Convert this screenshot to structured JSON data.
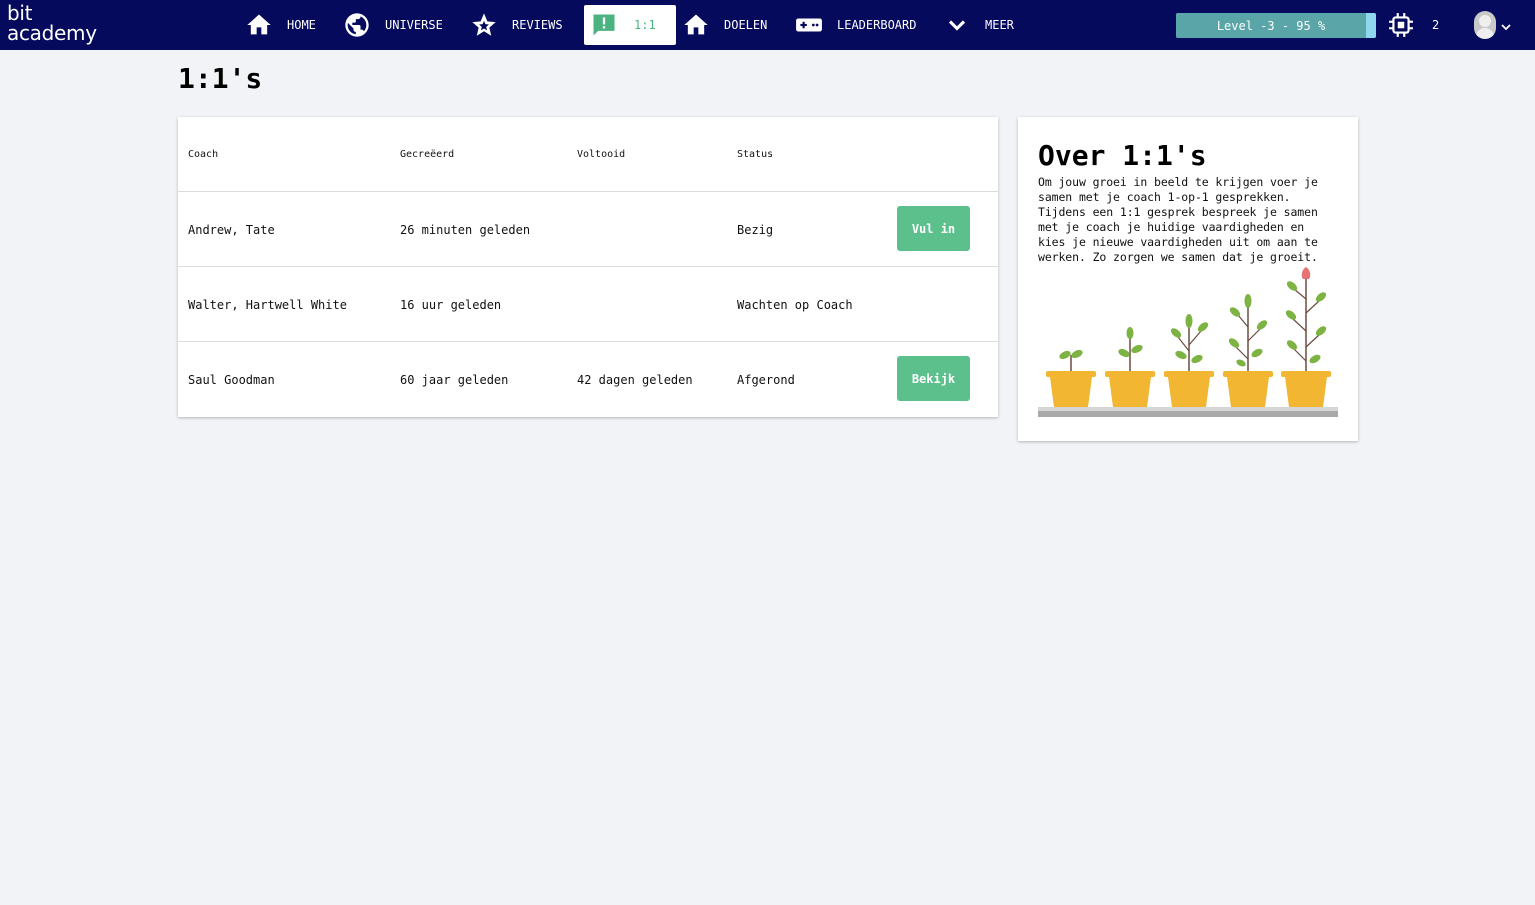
{
  "app": {
    "logo_line1": "bit",
    "logo_line2": "academy"
  },
  "nav": {
    "items": [
      {
        "label": "HOME",
        "icon": "home-icon"
      },
      {
        "label": "UNIVERSE",
        "icon": "globe-icon"
      },
      {
        "label": "REVIEWS",
        "icon": "star-icon"
      },
      {
        "label": "1:1",
        "icon": "chat-alert-icon",
        "active": true
      },
      {
        "label": "DOELEN",
        "icon": "home-icon"
      },
      {
        "label": "LEADERBOARD",
        "icon": "gamepad-icon"
      },
      {
        "label": "MEER",
        "icon": "chevron-down-icon"
      }
    ]
  },
  "level": {
    "text": "Level -3 - 95 %",
    "progress": 0.95
  },
  "chip_count": "2",
  "page": {
    "title": "1:1's"
  },
  "table": {
    "headers": [
      "Coach",
      "Gecreëerd",
      "Voltooid",
      "Status"
    ],
    "rows": [
      {
        "coach": "Andrew, Tate",
        "created": "26 minuten geleden",
        "completed": "",
        "status": "Bezig",
        "action": "Vul in"
      },
      {
        "coach": "Walter, Hartwell White",
        "created": "16 uur geleden",
        "completed": "",
        "status": "Wachten op Coach",
        "action": ""
      },
      {
        "coach": "Saul Goodman",
        "created": "60 jaar geleden",
        "completed": "42 dagen geleden",
        "status": "Afgerond",
        "action": "Bekijk"
      }
    ]
  },
  "info": {
    "title": "Over 1:1's",
    "text": "Om jouw groei in beeld te krijgen voer je samen met je coach 1-op-1 gesprekken. Tijdens een 1:1 gesprek bespreek je samen met je coach je huidige vaardigheden en kies je nieuwe vaardigheden uit om aan te werken. Zo zorgen we samen dat je groeit."
  },
  "colors": {
    "nav_bg": "#050a5c",
    "accent": "#5bc08b",
    "pot": "#f2b632",
    "leaf": "#7cb342"
  }
}
